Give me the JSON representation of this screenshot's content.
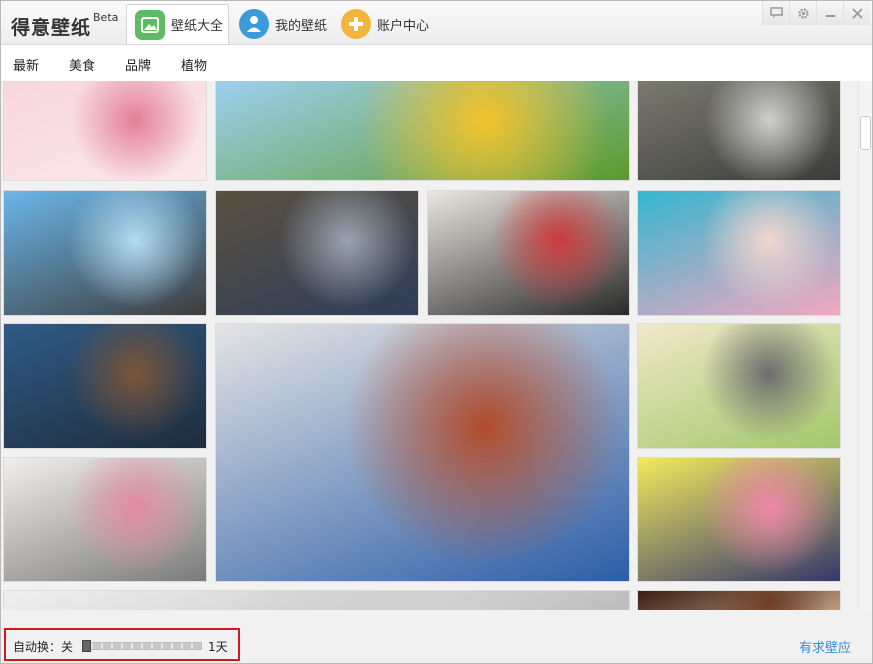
{
  "app": {
    "title": "得意壁纸",
    "beta": "Beta"
  },
  "tabs": [
    {
      "label": "壁纸大全",
      "icon": "picture-icon",
      "color": "#5dbb63"
    },
    {
      "label": "我的壁纸",
      "icon": "user-icon",
      "color": "#3b9bd8"
    },
    {
      "label": "账户中心",
      "icon": "plus-icon",
      "color": "#f3b43c"
    }
  ],
  "window_controls": [
    "message-icon",
    "settings-icon",
    "minimize-icon",
    "close-icon"
  ],
  "categories": [
    "最新",
    "美食",
    "品牌",
    "植物"
  ],
  "gallery": {
    "tiles": [
      {
        "name": "pink-roses-wallpaper",
        "colors": [
          "#f7d7dd",
          "#e37f96",
          "#fbe8ec"
        ]
      },
      {
        "name": "sunflowers-wallpaper",
        "colors": [
          "#9ed0f0",
          "#f3c32a",
          "#5d9a2b"
        ]
      },
      {
        "name": "cars-and-models-wallpaper",
        "colors": [
          "#7a7a6e",
          "#cfcfcf",
          "#3c3c3c"
        ]
      },
      {
        "name": "sprout-on-beach-wallpaper",
        "colors": [
          "#6ab6e8",
          "#b5dcf3",
          "#3d3d3d"
        ]
      },
      {
        "name": "city-tram-wallpaper",
        "colors": [
          "#5a5040",
          "#9aa3b0",
          "#2f3e5a"
        ]
      },
      {
        "name": "father-and-child-wallpaper",
        "colors": [
          "#eae6e1",
          "#cc3b3b",
          "#2a2a2a"
        ]
      },
      {
        "name": "girl-by-pool-wallpaper",
        "colors": [
          "#34b7cf",
          "#f1d7cf",
          "#f3a7c0"
        ]
      },
      {
        "name": "girl-by-seaside-wallpaper",
        "colors": [
          "#2f5b86",
          "#7b5538",
          "#1e2c3c"
        ]
      },
      {
        "name": "celebrity-portrait-wallpaper",
        "colors": [
          "#e4e4e4",
          "#b24c2c",
          "#2c5ea7"
        ]
      },
      {
        "name": "cartoon-illustration-wallpaper",
        "colors": [
          "#f0e8c9",
          "#6d6d6d",
          "#a3c86a"
        ]
      },
      {
        "name": "plum-blossom-painting-wallpaper",
        "colors": [
          "#f1efec",
          "#e28ca0",
          "#7b7b7b"
        ]
      },
      {
        "name": "girl-fashion-wallpaper",
        "colors": [
          "#f2ea5d",
          "#ef88a8",
          "#35376a"
        ]
      },
      {
        "name": "partial-wallpaper-bottom-left",
        "colors": [
          "#efefef",
          "#d0d0d0",
          "#bbbbbb"
        ]
      },
      {
        "name": "coffee-cup-wallpaper",
        "colors": [
          "#3a1e14",
          "#6e3e26",
          "#c9a98a"
        ]
      }
    ]
  },
  "statusbar": {
    "auto_label": "自动换：",
    "auto_value": "关",
    "interval_label": "1天",
    "interval_level": 0.0,
    "request_link": "有求壁应",
    "highlight_color": "#d11a1a"
  }
}
